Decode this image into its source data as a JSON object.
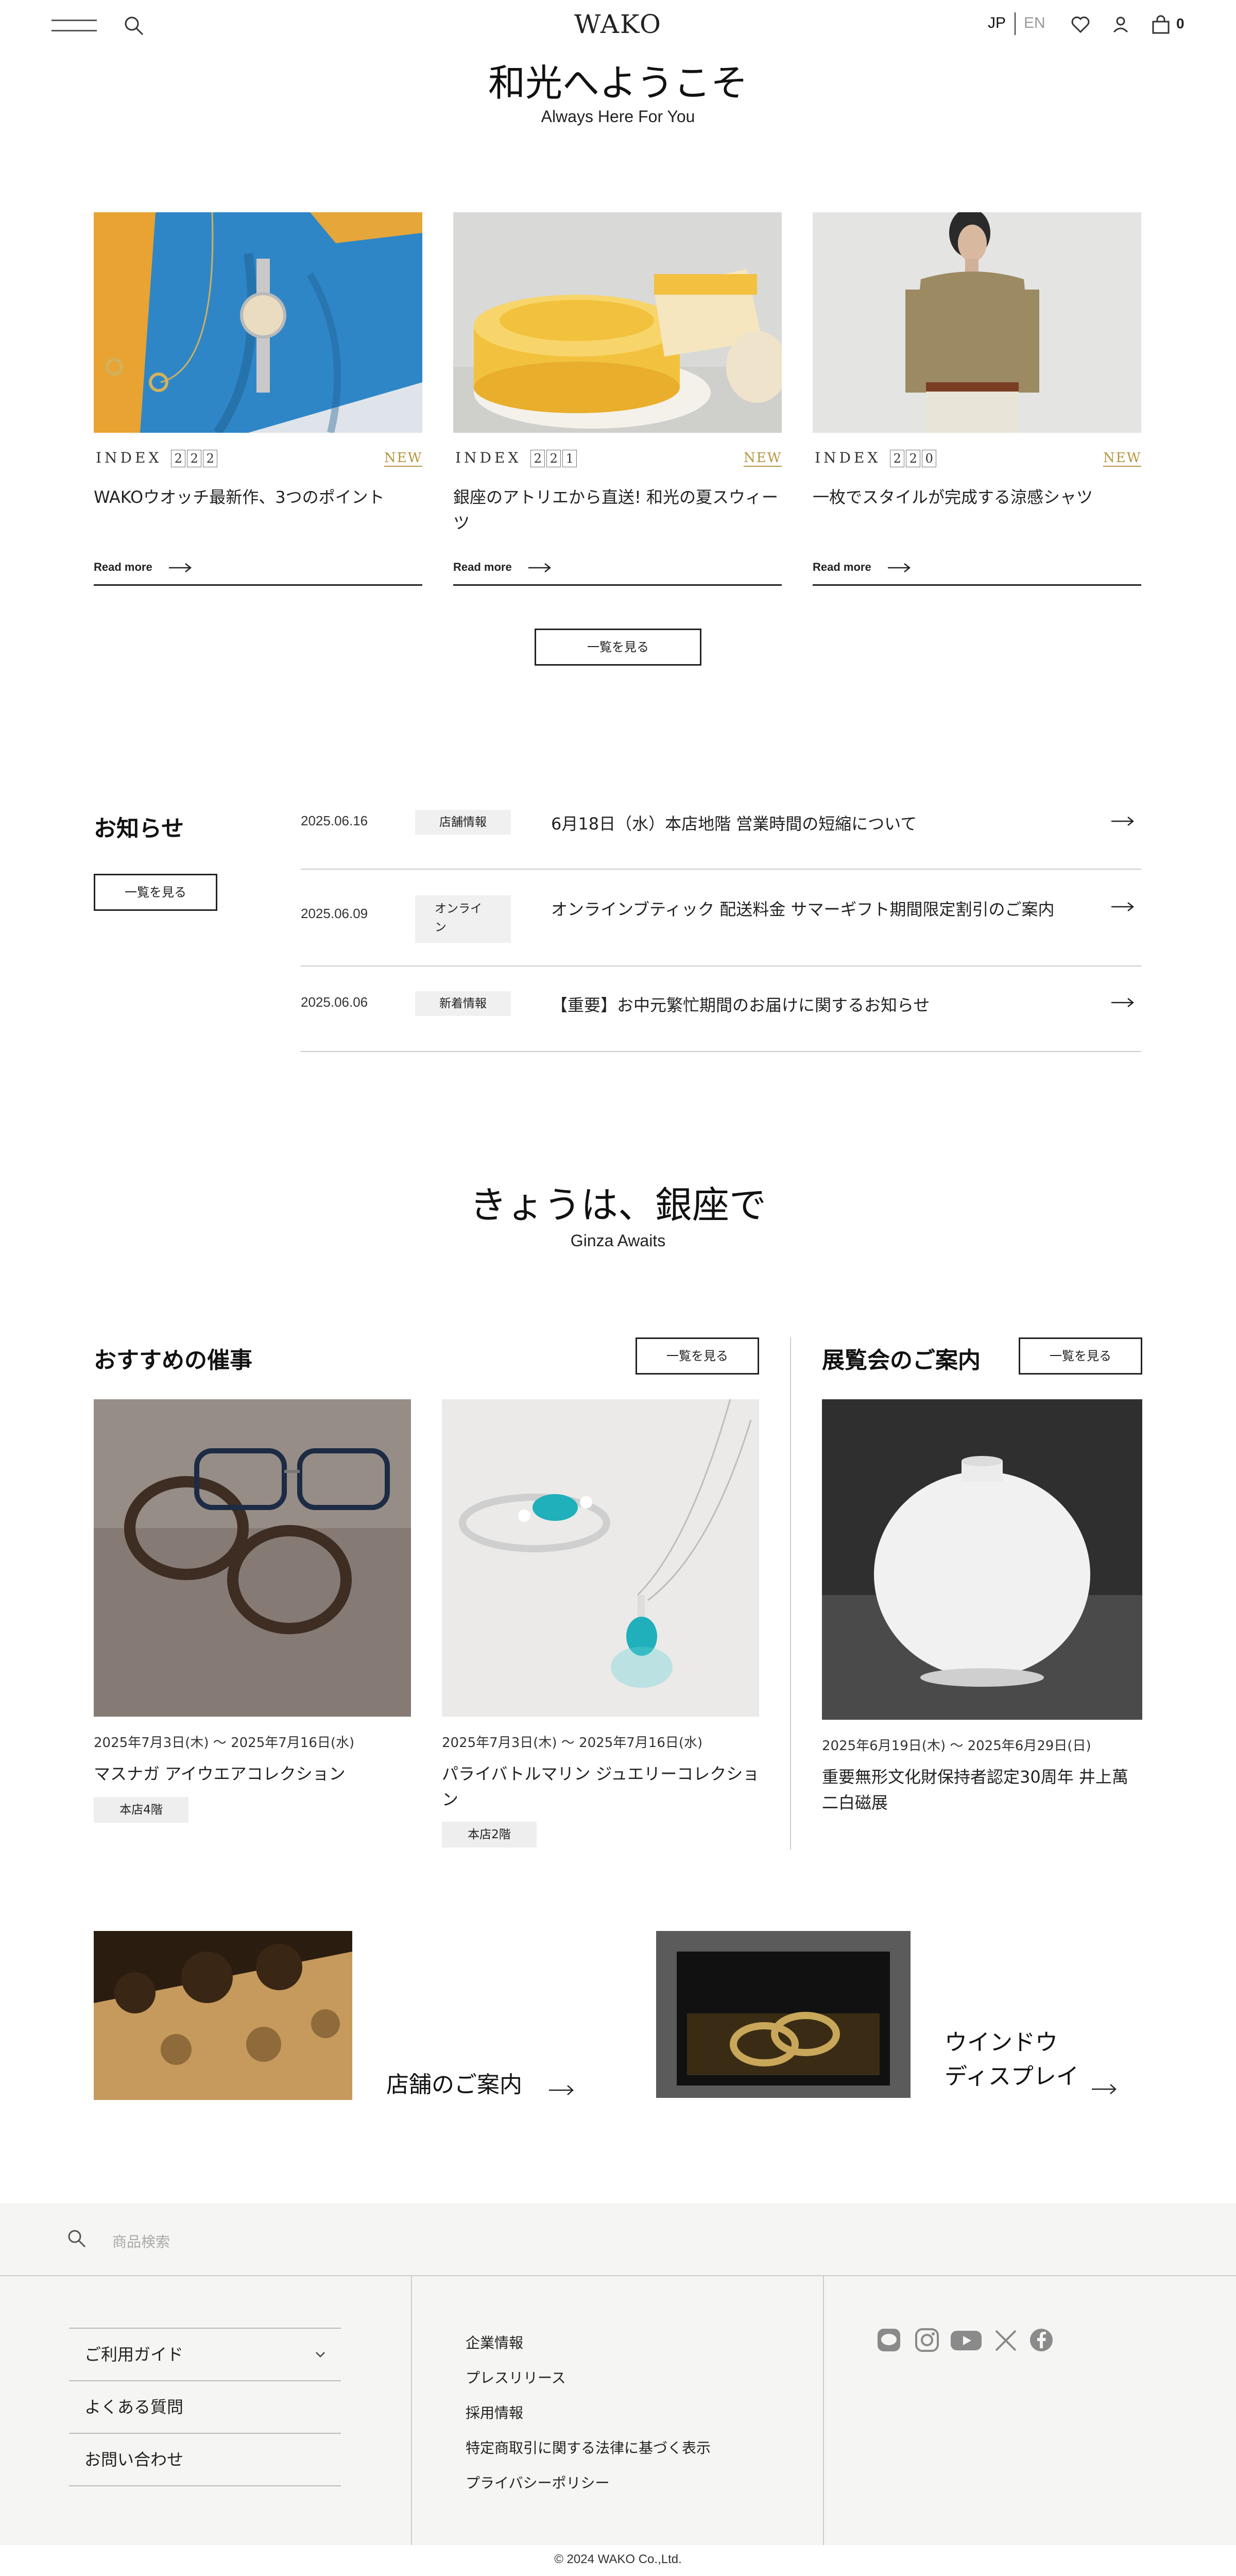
{
  "header": {
    "logo": "WAKO",
    "lang_jp": "JP",
    "lang_en": "EN",
    "cart_count": "0",
    "icons": [
      "menu-icon",
      "search-icon",
      "heart-icon",
      "user-icon",
      "bag-icon"
    ]
  },
  "hero": {
    "title": "和光へようこそ",
    "subtitle": "Always Here For You"
  },
  "index_cards": [
    {
      "index_label": "INDEX",
      "index_num": [
        "2",
        "2",
        "2"
      ],
      "badge": "NEW",
      "title": "WAKOウオッチ最新作、3つのポイント",
      "read_more": "Read more"
    },
    {
      "index_label": "INDEX",
      "index_num": [
        "2",
        "2",
        "1"
      ],
      "badge": "NEW",
      "title_line1": "銀座のアトリエから直送! 和光の夏スウィー",
      "title_line2": "ツ",
      "read_more": "Read more"
    },
    {
      "index_label": "INDEX",
      "index_num": [
        "2",
        "2",
        "0"
      ],
      "badge": "NEW",
      "title": "一枚でスタイルが完成する涼感シャツ",
      "read_more": "Read more"
    }
  ],
  "view_all": "一覧を見る",
  "news": {
    "title": "お知らせ",
    "button": "一覧を見る",
    "items": [
      {
        "date": "2025.06.16",
        "tag": "店舗情報",
        "text": "6月18日（水）本店地階 営業時間の短縮について"
      },
      {
        "date": "2025.06.09",
        "tag_line1": "オンライ",
        "tag_line2": "ン",
        "text": "オンラインブティック 配送料金 サマーギフト期間限定割引のご案内"
      },
      {
        "date": "2025.06.06",
        "tag": "新着情報",
        "text": "【重要】お中元繁忙期間のお届けに関するお知らせ"
      }
    ]
  },
  "ginza": {
    "title": "きょうは、銀座で",
    "subtitle": "Ginza Awaits"
  },
  "events": {
    "title": "おすすめの催事",
    "button": "一覧を見る",
    "items": [
      {
        "date": "2025年7月3日(木) 〜 2025年7月16日(水)",
        "title": "マスナガ アイウエアコレクション",
        "floor": "本店4階"
      },
      {
        "date": "2025年7月3日(木) 〜 2025年7月16日(水)",
        "title_line1": "パライバトルマリン ジュエリーコレクショ",
        "title_line2": "ン",
        "floor": "本店2階"
      }
    ]
  },
  "exhibitions": {
    "title": "展覧会のご案内",
    "button": "一覧を見る",
    "item": {
      "date": "2025年6月19日(木) 〜 2025年6月29日(日)",
      "title_line1": "重要無形文化財保持者認定30周年 井上萬",
      "title_line2": "二白磁展"
    }
  },
  "links": {
    "store": "店舗のご案内",
    "window_line1": "ウインドウ",
    "window_line2": "ディスプレイ"
  },
  "footer": {
    "search_placeholder": "商品検索",
    "guide": [
      "ご利用ガイド",
      "よくある質問",
      "お問い合わせ"
    ],
    "corporate": [
      "企業情報",
      "プレスリリース",
      "採用情報",
      "特定商取引に関する法律に基づく表示",
      "プライバシーポリシー"
    ],
    "social_icons": [
      "line-icon",
      "instagram-icon",
      "youtube-icon",
      "x-icon",
      "facebook-icon"
    ],
    "copyright": "© 2024 WAKO Co.,Ltd."
  },
  "colors": {
    "accent_gold": "#b59540",
    "footer_bg": "#f5f5f3",
    "text": "#222222"
  }
}
